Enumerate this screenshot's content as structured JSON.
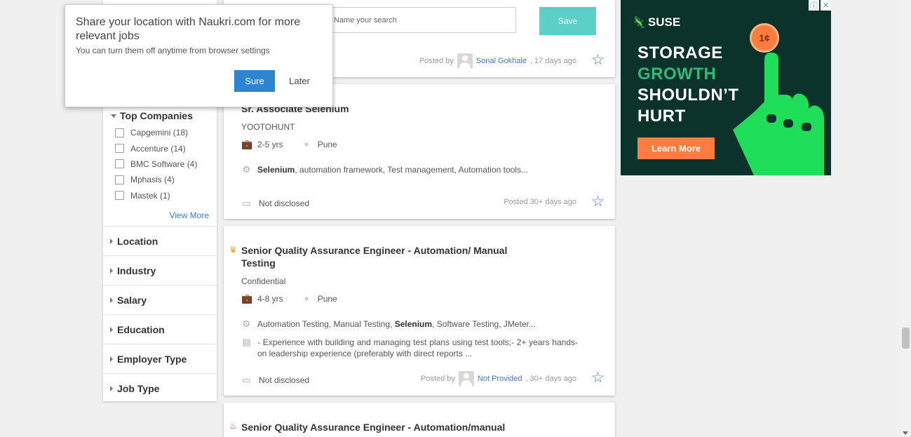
{
  "popup": {
    "title": "Share your location with Naukri.com for more relevant jobs",
    "subtitle": "You can turn them off anytime from browser settings",
    "sure_label": "Sure",
    "later_label": "Later"
  },
  "saved_search": {
    "placeholder": "Name your search",
    "save_label": "Save"
  },
  "sidebar": {
    "top_companies_heading": "Top Companies",
    "companies": [
      "Capgemini (18)",
      "Accenture (14)",
      "BMC Software (4)",
      "Mphasis (4)",
      "Mastek (1)"
    ],
    "view_more": "View More",
    "sections": [
      "Location",
      "Industry",
      "Salary",
      "Education",
      "Employer Type",
      "Job Type"
    ]
  },
  "jobs": [
    {
      "posted_prefix": "Posted by",
      "poster": "Sonal Gokhale",
      "posted_suffix": ", 17 days ago"
    },
    {
      "title": "Sr. Associate Selenium",
      "company": "YOOTOHUNT",
      "experience": "2-5 yrs",
      "location": "Pune",
      "skills_highlight": "Selenium",
      "skills_rest": ", automation framework, Test management, Automation tools...",
      "salary": "Not disclosed",
      "posted": "Posted  30+ days ago"
    },
    {
      "title_line1": "Senior Quality Assurance Engineer - Automation/ Manual",
      "title_line2": "Testing",
      "company": "Confidential",
      "experience": "4-8 yrs",
      "location": "Pune",
      "skills_pre": "Automation Testing, Manual Testing, ",
      "skills_highlight": "Selenium",
      "skills_rest": ", Software Testing, JMeter...",
      "description": "- Experience with building and managing test plans using test tools;- 2+ years hands-on leadership experience (preferably with direct reports ...",
      "salary": "Not disclosed",
      "posted_prefix": "Posted by",
      "poster": "Not Provided",
      "posted_suffix": ", 30+ days ago"
    },
    {
      "title": "Senior Quality Assurance Engineer - Automation/manual"
    }
  ],
  "ad": {
    "brand": "SUSE",
    "line1": "STORAGE",
    "line2": "GROWTH",
    "line3": "SHOULDN’T",
    "line4": "HURT",
    "cta": "Learn More",
    "coin": "1¢",
    "accent": "#30ba78"
  }
}
